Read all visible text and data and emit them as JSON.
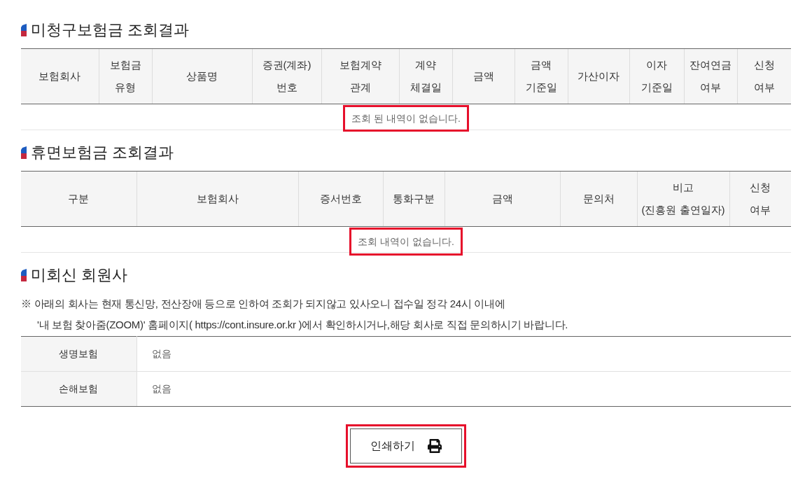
{
  "unclaimed": {
    "title": "미청구보험금 조회결과",
    "columns": [
      [
        "보험회사"
      ],
      [
        "보험금",
        "유형"
      ],
      [
        "상품명"
      ],
      [
        "증권(계좌)",
        "번호"
      ],
      [
        "보험계약",
        "관계"
      ],
      [
        "계약",
        "체결일"
      ],
      [
        "금액"
      ],
      [
        "금액",
        "기준일"
      ],
      [
        "가산이자"
      ],
      [
        "이자",
        "기준일"
      ],
      [
        "잔여연금",
        "여부"
      ],
      [
        "신청",
        "여부"
      ]
    ],
    "empty_message": {
      "text": "조회 된 내역이 없습니다.",
      "highlighted": true
    }
  },
  "dormant": {
    "title": "휴면보험금 조회결과",
    "columns": [
      [
        "구분"
      ],
      [
        "보험회사"
      ],
      [
        "증서번호"
      ],
      [
        "통화구분"
      ],
      [
        "금액"
      ],
      [
        "문의처"
      ],
      [
        "비고",
        "(진흥원 출연일자)"
      ],
      [
        "신청",
        "여부"
      ]
    ],
    "empty_message": {
      "text": "조회 내역이 없습니다.",
      "highlighted": true
    }
  },
  "non_responding": {
    "title": "미회신 회원사",
    "notice": [
      "※ 아래의 회사는 현재 통신망, 전산장애 등으로 인하여 조회가 되지않고 있사오니 접수일 정각 24시 이내에",
      "'내 보험 찾아줌(ZOOM)' 홈페이지( https://cont.insure.or.kr )에서 확인하시거나,해당 회사로 직접 문의하시기 바랍니다."
    ],
    "rows": [
      {
        "label": "생명보험",
        "value": "없음"
      },
      {
        "label": "손해보험",
        "value": "없음"
      }
    ]
  },
  "print_button": {
    "label": "인쇄하기",
    "highlighted": true
  }
}
